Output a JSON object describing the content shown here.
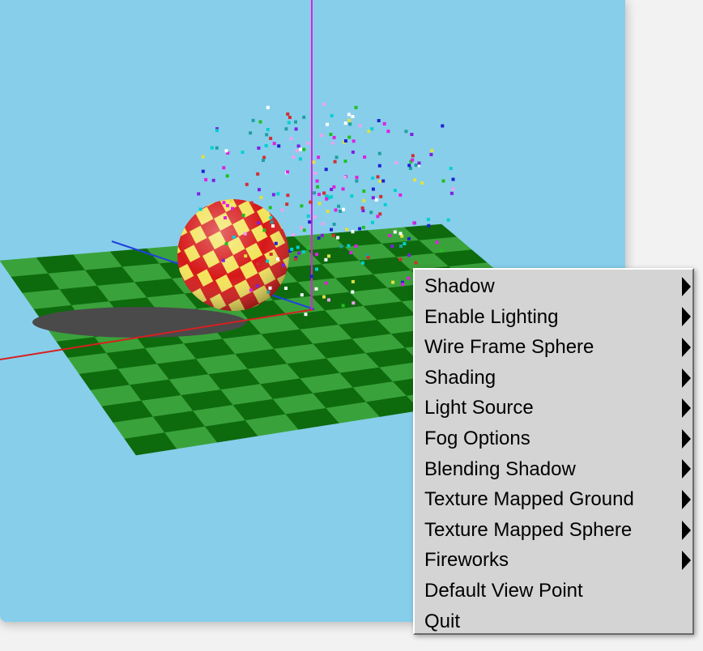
{
  "window": {
    "background": "#87ceeb"
  },
  "scene": {
    "ground_colors": [
      "#3aa23a",
      "#0d6b0d"
    ],
    "sphere_colors": [
      "#d61818",
      "#f3e35a"
    ],
    "shadow_color": "#4a4a4a",
    "axis_colors": {
      "x": "#d62020",
      "y": "#e020e0",
      "z": "#2040e0"
    },
    "firework_colors": [
      "#e020e0",
      "#2020d0",
      "#20c020",
      "#e0e040",
      "#00d0d0",
      "#ffffff",
      "#d03030",
      "#8020e0",
      "#20a0a0",
      "#f0a0f0"
    ]
  },
  "menu": {
    "items": [
      {
        "label": "Shadow",
        "submenu": true
      },
      {
        "label": "Enable Lighting",
        "submenu": true
      },
      {
        "label": "Wire Frame Sphere",
        "submenu": true
      },
      {
        "label": "Shading",
        "submenu": true
      },
      {
        "label": "Light Source",
        "submenu": true
      },
      {
        "label": "Fog Options",
        "submenu": true
      },
      {
        "label": "Blending Shadow",
        "submenu": true
      },
      {
        "label": "Texture Mapped Ground",
        "submenu": true
      },
      {
        "label": "Texture Mapped Sphere",
        "submenu": true
      },
      {
        "label": "Fireworks",
        "submenu": true
      },
      {
        "label": "Default View Point",
        "submenu": false
      },
      {
        "label": "Quit",
        "submenu": false
      }
    ]
  }
}
